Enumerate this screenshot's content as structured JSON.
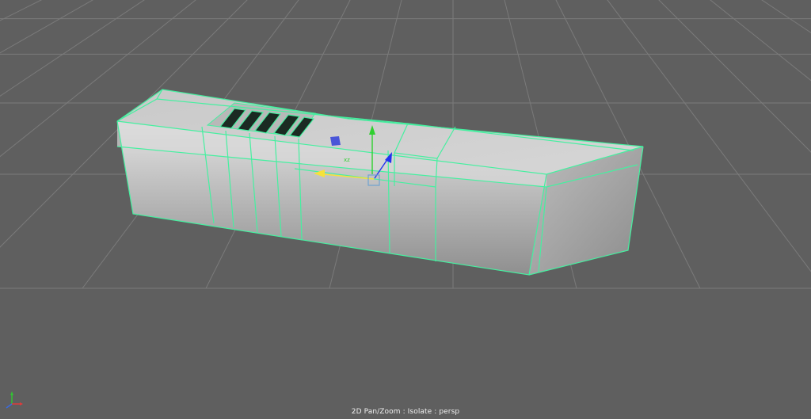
{
  "viewport": {
    "hud_text": "2D Pan/Zoom : Isolate : persp"
  },
  "colors": {
    "background": "#5f5f5f",
    "grid_line": "#7b7b7b",
    "wireframe": "#45f0a0",
    "move_x_arrow": "#f5e23a",
    "move_y_arrow": "#2fd02f",
    "move_z_arrow": "#2233ee",
    "center_handle": "#6fa3d0",
    "rotate_plane_handle": "#4a56d8"
  },
  "icons": {
    "axis_indicator": "xyz-axis-icon",
    "move_manipulator": "move-manipulator-icon"
  }
}
